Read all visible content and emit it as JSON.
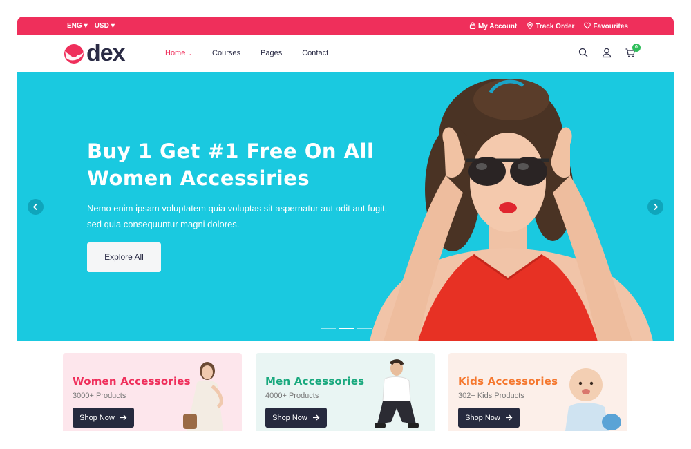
{
  "topbar": {
    "language": "ENG",
    "currency": "USD",
    "links": [
      {
        "label": "My Account",
        "icon": "lock-icon"
      },
      {
        "label": "Track Order",
        "icon": "location-pin-icon"
      },
      {
        "label": "Favourites",
        "icon": "heart-icon"
      }
    ]
  },
  "brand": {
    "name": "dex",
    "accent": "#ef2f5b"
  },
  "nav": {
    "items": [
      {
        "label": "Home",
        "active": true
      },
      {
        "label": "Courses"
      },
      {
        "label": "Pages"
      },
      {
        "label": "Contact"
      }
    ]
  },
  "header_icons": {
    "cart_count": "0"
  },
  "hero": {
    "title_line1": "Buy 1 Get #1 Free On All",
    "title_line2": "Women Accessiries",
    "description_line1": "Nemo enim ipsam voluptatem quia voluptas sit aspernatur aut odit aut fugit,",
    "description_line2": "sed quia consequuntur magni dolores.",
    "button_label": "Explore All",
    "background": "#1ac9e0",
    "slides": 3,
    "active_slide": 2
  },
  "categories": [
    {
      "title": "Women Accessories",
      "subtitle": "3000+ Products",
      "button": "Shop Now",
      "color": "#ef2f5b"
    },
    {
      "title": "Men Accessories",
      "subtitle": "4000+ Products",
      "button": "Shop Now",
      "color": "#1aa97e"
    },
    {
      "title": "Kids Accessories",
      "subtitle": "302+ Kids Products",
      "button": "Shop Now",
      "color": "#f5782f"
    }
  ]
}
